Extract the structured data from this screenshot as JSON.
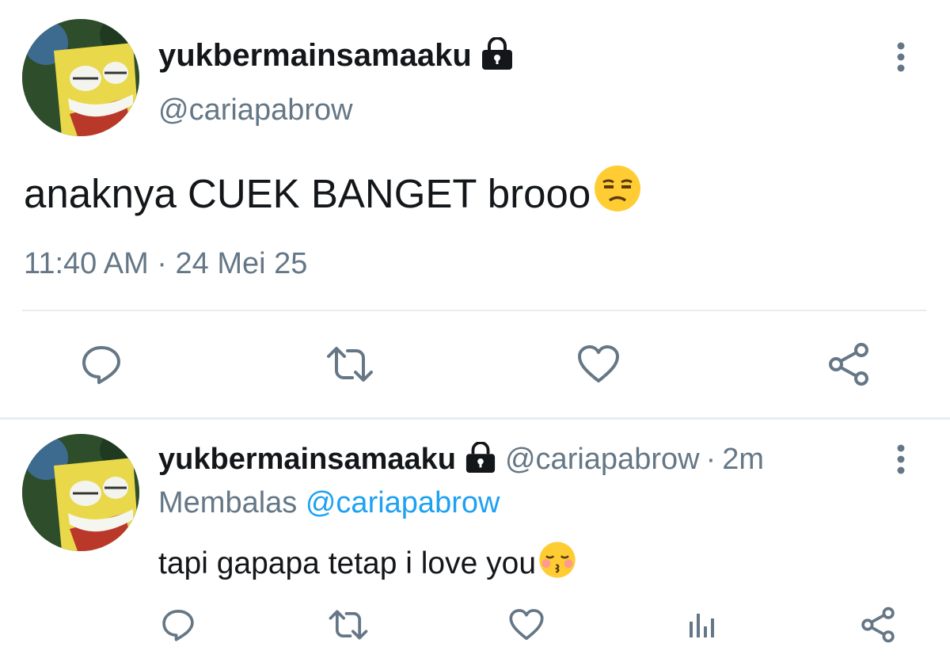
{
  "main_tweet": {
    "display_name": "yukbermainsamaaku",
    "handle": "@cariapabrow",
    "text": "anaknya CUEK BANGET brooo",
    "emoji": "unamused-face",
    "time": "11:40 AM",
    "separator": "·",
    "date": "24 Mei 25"
  },
  "reply": {
    "display_name": "yukbermainsamaaku",
    "handle": "@cariapabrow",
    "separator": "·",
    "age": "2m",
    "replying_prefix": "Membalas",
    "replying_to": "@cariapabrow",
    "text": "tapi gapapa tetap i love you",
    "emoji": "kissing-face-closed-eyes"
  },
  "colors": {
    "name": "#14171a",
    "secondary": "#657786",
    "link": "#1da1f2",
    "icon": "#657786",
    "divider": "#e6ecf0"
  },
  "icons": {
    "avatar": "spongebob-avatar",
    "lock": "lock-icon",
    "more": "more-vertical-icon",
    "reply": "reply-icon",
    "retweet": "retweet-icon",
    "like": "heart-icon",
    "share": "share-icon",
    "analytics": "analytics-icon"
  }
}
